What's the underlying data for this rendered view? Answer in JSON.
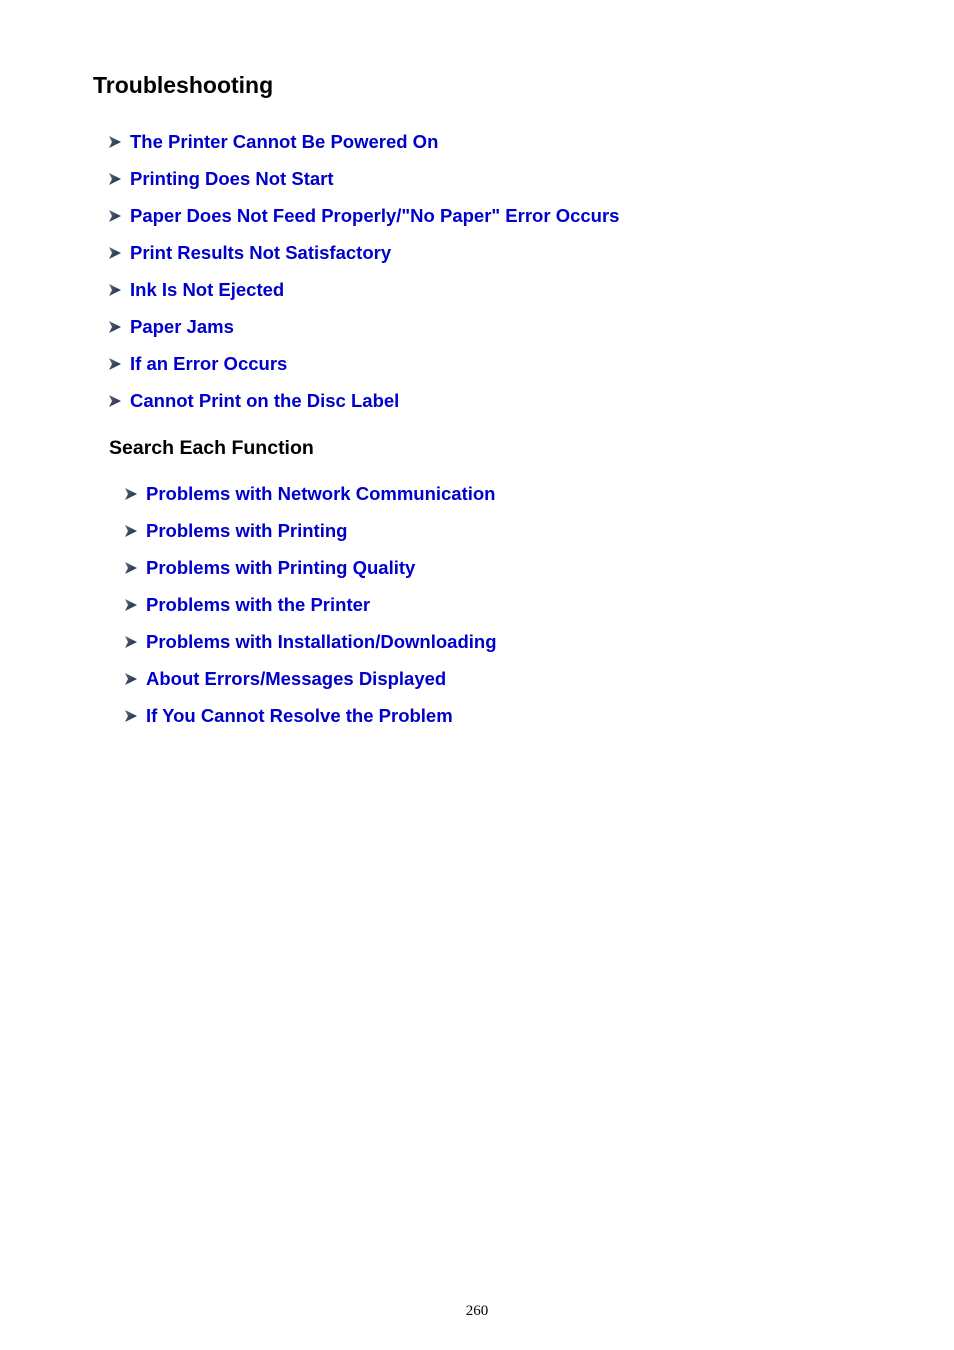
{
  "page": {
    "title": "Troubleshooting",
    "page_number": "260",
    "link_color": "#0000CC"
  },
  "main_links": [
    {
      "label": "The Printer Cannot Be Powered On",
      "icon": "arrow-right-icon"
    },
    {
      "label": "Printing Does Not Start",
      "icon": "arrow-right-icon"
    },
    {
      "label": "Paper Does Not Feed Properly/\"No Paper\" Error Occurs",
      "icon": "arrow-right-icon"
    },
    {
      "label": "Print Results Not Satisfactory",
      "icon": "arrow-right-icon"
    },
    {
      "label": "Ink Is Not Ejected",
      "icon": "arrow-right-icon"
    },
    {
      "label": "Paper Jams",
      "icon": "arrow-right-icon"
    },
    {
      "label": "If an Error Occurs",
      "icon": "arrow-right-icon"
    },
    {
      "label": "Cannot Print on the Disc Label",
      "icon": "arrow-right-icon"
    }
  ],
  "search_section": {
    "heading": "Search Each Function",
    "links": [
      {
        "label": "Problems with Network Communication",
        "icon": "arrow-right-icon"
      },
      {
        "label": "Problems with Printing",
        "icon": "arrow-right-icon"
      },
      {
        "label": "Problems with Printing Quality",
        "icon": "arrow-right-icon"
      },
      {
        "label": "Problems with the Printer",
        "icon": "arrow-right-icon"
      },
      {
        "label": "Problems with Installation/Downloading",
        "icon": "arrow-right-icon"
      },
      {
        "label": "About Errors/Messages Displayed",
        "icon": "arrow-right-icon"
      },
      {
        "label": "If You Cannot Resolve the Problem",
        "icon": "arrow-right-icon"
      }
    ]
  }
}
